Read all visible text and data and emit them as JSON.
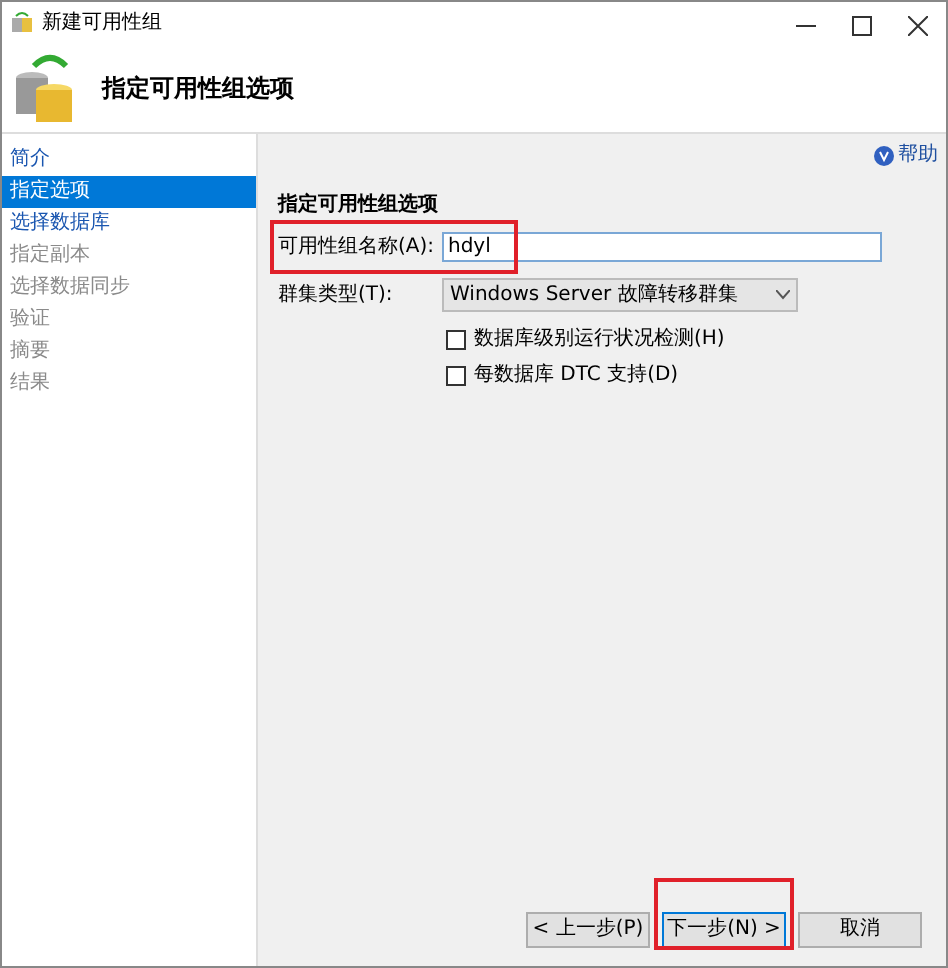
{
  "window": {
    "title": "新建可用性组"
  },
  "header": {
    "title": "指定可用性组选项"
  },
  "sidebar": {
    "items": [
      {
        "label": "简介",
        "selected": false,
        "enabled": true
      },
      {
        "label": "指定选项",
        "selected": true,
        "enabled": true
      },
      {
        "label": "选择数据库",
        "selected": false,
        "enabled": true
      },
      {
        "label": "指定副本",
        "selected": false,
        "enabled": false
      },
      {
        "label": "选择数据同步",
        "selected": false,
        "enabled": false
      },
      {
        "label": "验证",
        "selected": false,
        "enabled": false
      },
      {
        "label": "摘要",
        "selected": false,
        "enabled": false
      },
      {
        "label": "结果",
        "selected": false,
        "enabled": false
      }
    ]
  },
  "help": "帮助",
  "section_title": "指定可用性组选项",
  "name_field": {
    "label": "可用性组名称(A):",
    "value": "hdyl",
    "highlighted": true
  },
  "cluster_type": {
    "label": "群集类型(T):",
    "value": "Windows Server 故障转移群集"
  },
  "options": [
    {
      "label": "数据库级别运行状况检测(H)",
      "checked": false
    },
    {
      "label": "每数据库 DTC 支持(D)",
      "checked": false
    }
  ],
  "buttons": [
    {
      "label": "< 上一步(P)",
      "highlighted": false,
      "default": false
    },
    {
      "label": "下一步(N) >",
      "highlighted": true,
      "default": true
    },
    {
      "label": "取消",
      "highlighted": false,
      "default": false
    }
  ]
}
